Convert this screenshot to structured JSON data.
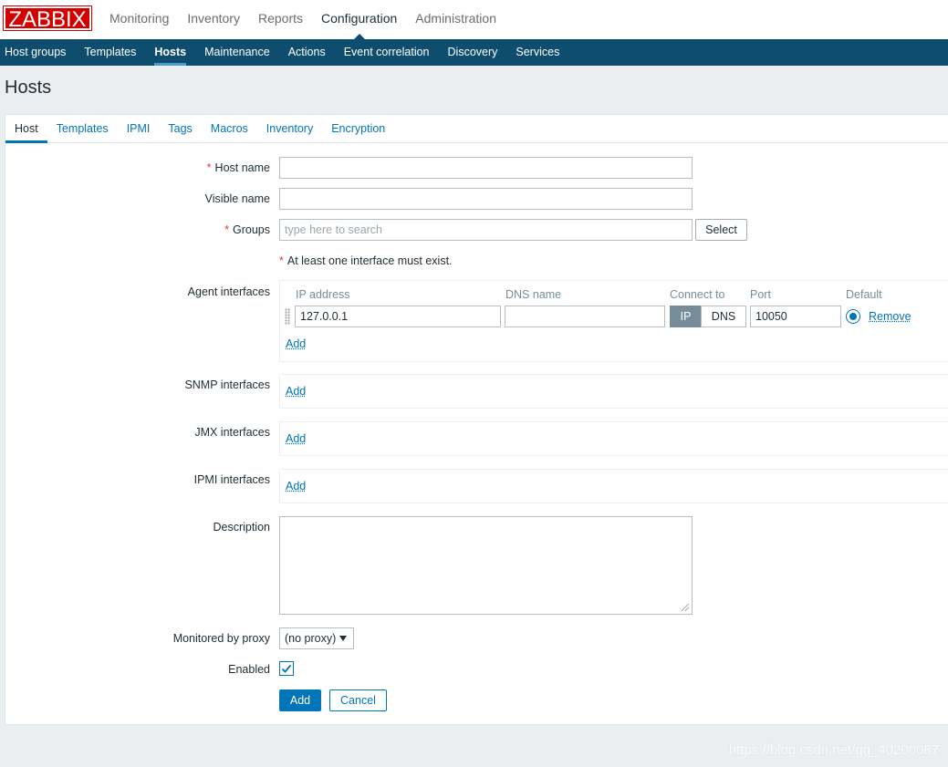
{
  "header": {
    "logo": "ZABBIX",
    "menu": [
      {
        "label": "Monitoring"
      },
      {
        "label": "Inventory"
      },
      {
        "label": "Reports"
      },
      {
        "label": "Configuration"
      },
      {
        "label": "Administration"
      }
    ],
    "active_menu": "Configuration"
  },
  "subnav": {
    "items": [
      {
        "label": "Host groups"
      },
      {
        "label": "Templates"
      },
      {
        "label": "Hosts"
      },
      {
        "label": "Maintenance"
      },
      {
        "label": "Actions"
      },
      {
        "label": "Event correlation"
      },
      {
        "label": "Discovery"
      },
      {
        "label": "Services"
      }
    ],
    "active_item": "Hosts"
  },
  "page": {
    "title": "Hosts"
  },
  "tabs": [
    {
      "label": "Host"
    },
    {
      "label": "Templates"
    },
    {
      "label": "IPMI"
    },
    {
      "label": "Tags"
    },
    {
      "label": "Macros"
    },
    {
      "label": "Inventory"
    },
    {
      "label": "Encryption"
    }
  ],
  "form": {
    "required_mark": "*",
    "host_name": {
      "label": "Host name",
      "value": ""
    },
    "visible_name": {
      "label": "Visible name",
      "value": ""
    },
    "groups": {
      "label": "Groups",
      "placeholder": "type here to search",
      "select_label": "Select"
    },
    "interface_note": "At least one interface must exist.",
    "agent_interfaces": {
      "label": "Agent interfaces",
      "columns": {
        "ip": "IP address",
        "dns": "DNS name",
        "connect": "Connect to",
        "port": "Port",
        "default": "Default"
      },
      "row": {
        "ip": "127.0.0.1",
        "dns": "",
        "connect_ip": "IP",
        "connect_dns": "DNS",
        "port": "10050",
        "remove": "Remove"
      },
      "add": "Add"
    },
    "snmp_interfaces": {
      "label": "SNMP interfaces",
      "add": "Add"
    },
    "jmx_interfaces": {
      "label": "JMX interfaces",
      "add": "Add"
    },
    "ipmi_interfaces": {
      "label": "IPMI interfaces",
      "add": "Add"
    },
    "description": {
      "label": "Description",
      "value": ""
    },
    "proxy": {
      "label": "Monitored by proxy",
      "value": "(no proxy)"
    },
    "enabled": {
      "label": "Enabled",
      "checked": true
    },
    "buttons": {
      "add": "Add",
      "cancel": "Cancel"
    }
  },
  "watermark": "https://blog.csdn.net/qq_40200087",
  "colors": {
    "brand_red": "#d40000",
    "nav_bg": "#0e4d6e",
    "link": "#0275b8",
    "required": "#e33734"
  }
}
